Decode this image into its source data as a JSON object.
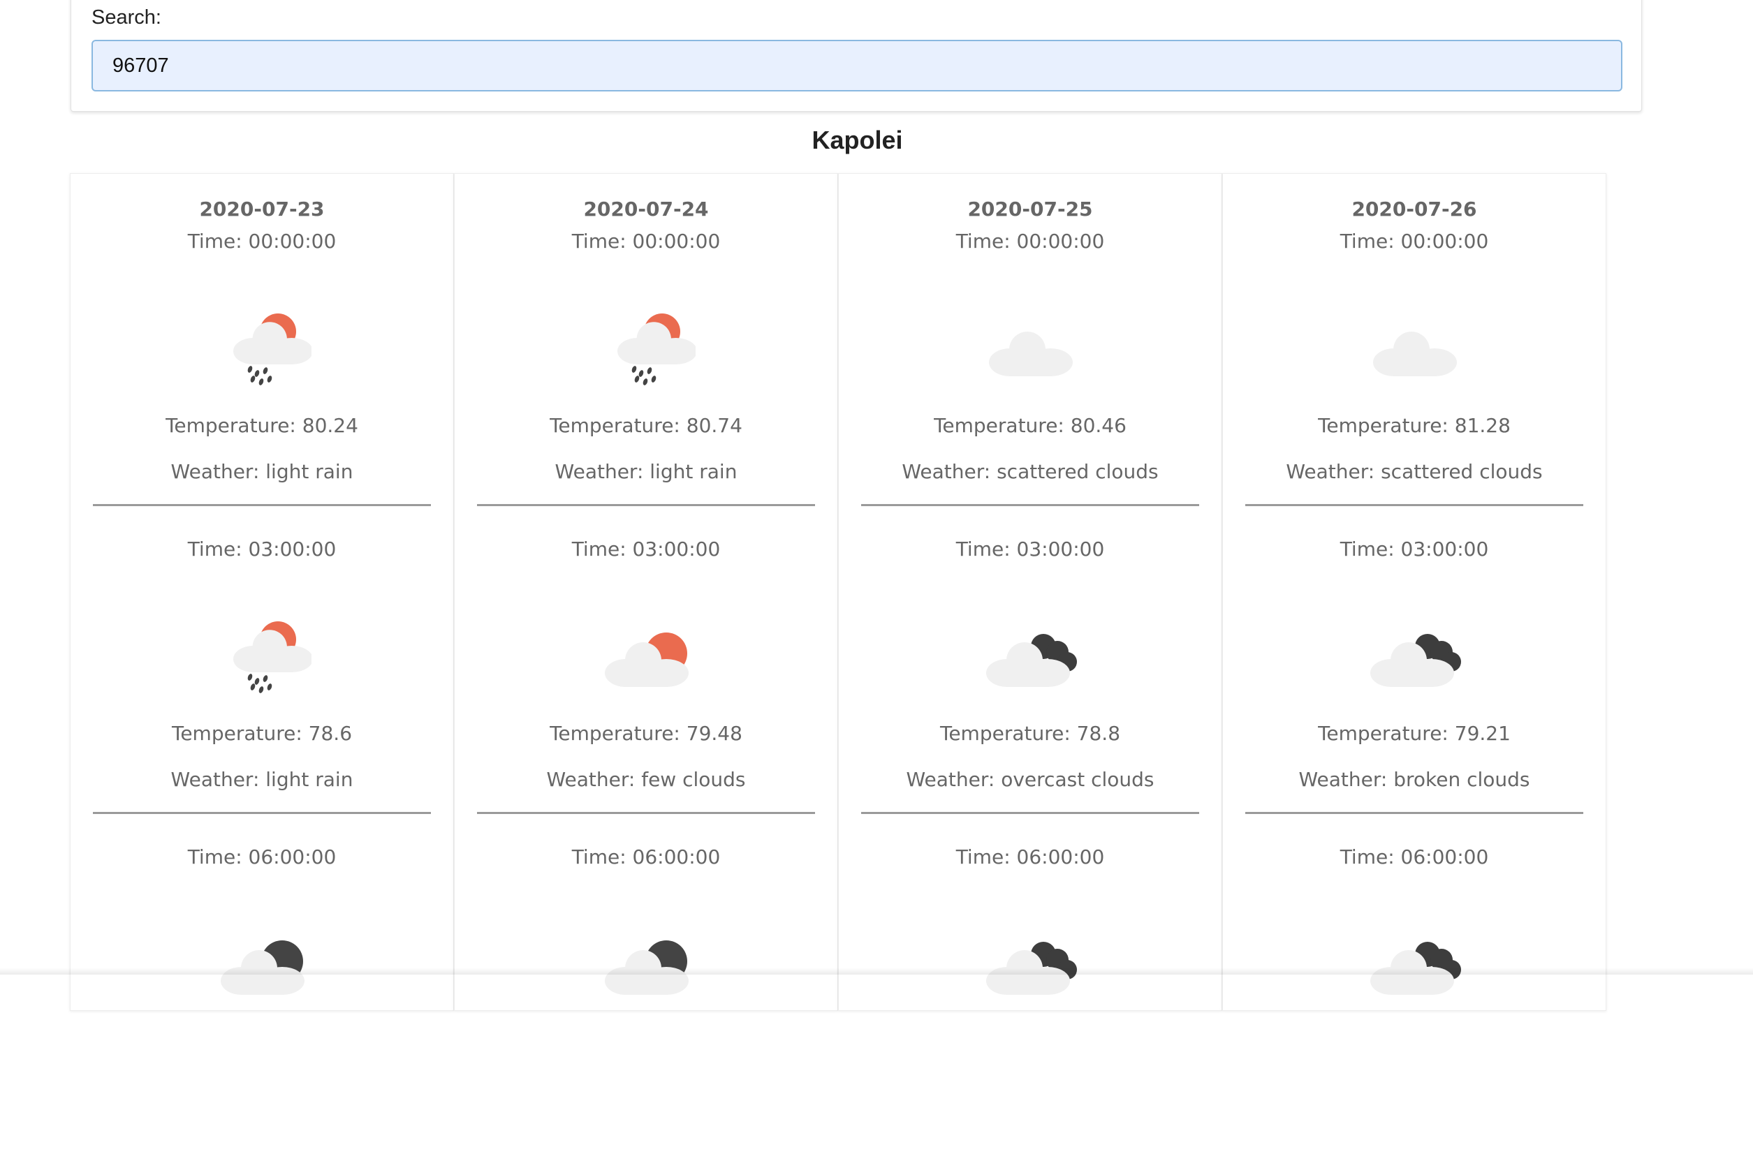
{
  "search": {
    "label": "Search:",
    "value": "96707"
  },
  "city": "Kapolei",
  "colors": {
    "sun": "#ea6b4f",
    "moon": "#444444",
    "cloud_light": "#f0f0f0",
    "cloud_dark": "#3d3d3d",
    "rain": "#444444",
    "input_bg": "#e8f0fe",
    "input_border": "#8ab8e0"
  },
  "days": [
    {
      "date": "2020-07-23",
      "slots": [
        {
          "time": "Time: 00:00:00",
          "icon": "rain-sun-icon",
          "temperature": "Temperature: 80.24",
          "weather": "Weather: light rain"
        },
        {
          "time": "Time: 03:00:00",
          "icon": "rain-sun-icon",
          "temperature": "Temperature: 78.6",
          "weather": "Weather: light rain"
        },
        {
          "time": "Time: 06:00:00",
          "icon": "cloud-moon-icon",
          "temperature": "",
          "weather": ""
        }
      ]
    },
    {
      "date": "2020-07-24",
      "slots": [
        {
          "time": "Time: 00:00:00",
          "icon": "rain-sun-icon",
          "temperature": "Temperature: 80.74",
          "weather": "Weather: light rain"
        },
        {
          "time": "Time: 03:00:00",
          "icon": "cloud-sun-icon",
          "temperature": "Temperature: 79.48",
          "weather": "Weather: few clouds"
        },
        {
          "time": "Time: 06:00:00",
          "icon": "cloud-moon-icon",
          "temperature": "",
          "weather": ""
        }
      ]
    },
    {
      "date": "2020-07-25",
      "slots": [
        {
          "time": "Time: 00:00:00",
          "icon": "cloud-icon",
          "temperature": "Temperature: 80.46",
          "weather": "Weather: scattered clouds"
        },
        {
          "time": "Time: 03:00:00",
          "icon": "overcast-icon",
          "temperature": "Temperature: 78.8",
          "weather": "Weather: overcast clouds"
        },
        {
          "time": "Time: 06:00:00",
          "icon": "overcast-icon",
          "temperature": "",
          "weather": ""
        }
      ]
    },
    {
      "date": "2020-07-26",
      "slots": [
        {
          "time": "Time: 00:00:00",
          "icon": "cloud-icon",
          "temperature": "Temperature: 81.28",
          "weather": "Weather: scattered clouds"
        },
        {
          "time": "Time: 03:00:00",
          "icon": "overcast-icon",
          "temperature": "Temperature: 79.21",
          "weather": "Weather: broken clouds"
        },
        {
          "time": "Time: 06:00:00",
          "icon": "overcast-icon",
          "temperature": "",
          "weather": ""
        }
      ]
    }
  ]
}
